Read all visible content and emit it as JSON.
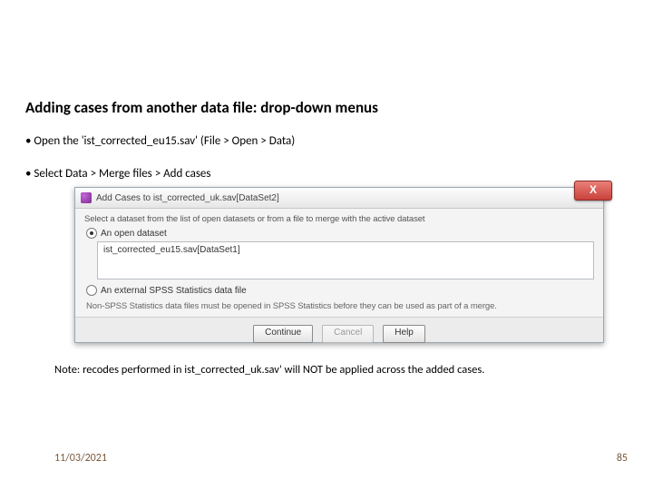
{
  "title": "Adding cases from another data file: drop-down menus",
  "bullets": [
    "Open the 'ist_corrected_eu15.sav' (File > Open > Data)",
    "Select Data > Merge files > Add cases"
  ],
  "dialog": {
    "title": "Add Cases to ist_corrected_uk.sav[DataSet2]",
    "instruction": "Select a dataset from the list of open datasets or from a file to merge with the active dataset",
    "radio_open_label": "An open dataset",
    "open_dataset_item": "ist_corrected_eu15.sav[DataSet1]",
    "radio_external_label": "An external SPSS Statistics data file",
    "hint": "Non-SPSS Statistics data files must be opened in SPSS Statistics before they can be used as part of a merge.",
    "buttons": {
      "continue": "Continue",
      "cancel": "Cancel",
      "help": "Help"
    },
    "close": "X"
  },
  "note": "Note: recodes performed in ist_corrected_uk.sav' will NOT be applied across the added cases.",
  "footer": {
    "date": "11/03/2021",
    "page": "85"
  }
}
